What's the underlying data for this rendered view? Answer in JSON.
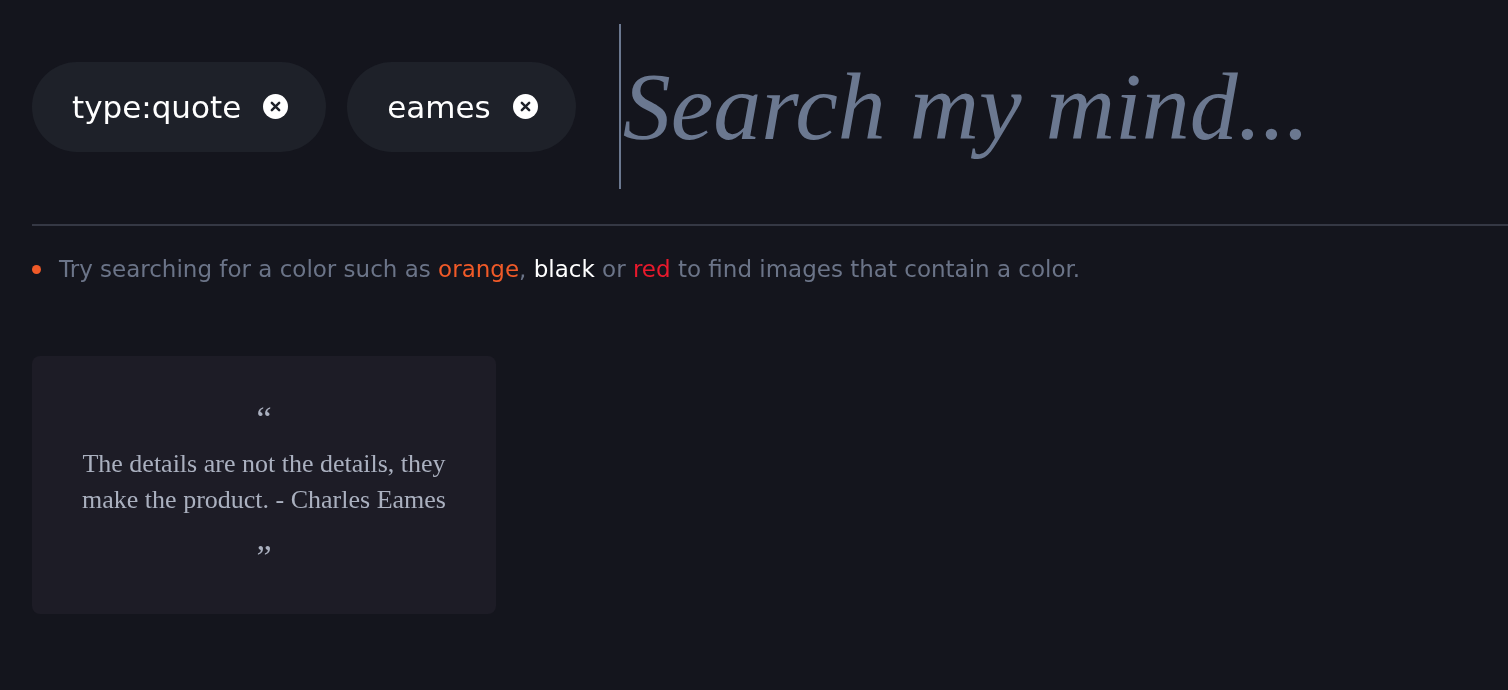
{
  "search": {
    "chips": [
      {
        "label": "type:quote"
      },
      {
        "label": "eames"
      }
    ],
    "placeholder": "Search my mind..."
  },
  "hint": {
    "parts": [
      {
        "text": "Try searching for a color such as ",
        "kind": "plain"
      },
      {
        "text": "orange",
        "kind": "color",
        "color": "#f05a28"
      },
      {
        "text": ", ",
        "kind": "plain"
      },
      {
        "text": "black",
        "kind": "color",
        "color": "#ffffff"
      },
      {
        "text": " or ",
        "kind": "plain"
      },
      {
        "text": "red",
        "kind": "color",
        "color": "#e8192c"
      },
      {
        "text": " to find images that contain a color.",
        "kind": "plain"
      }
    ]
  },
  "cards": [
    {
      "kind": "quote",
      "open_mark": "“",
      "text": "The details are not the details, they make the product. - Charles Eames",
      "close_mark": "”"
    }
  ]
}
